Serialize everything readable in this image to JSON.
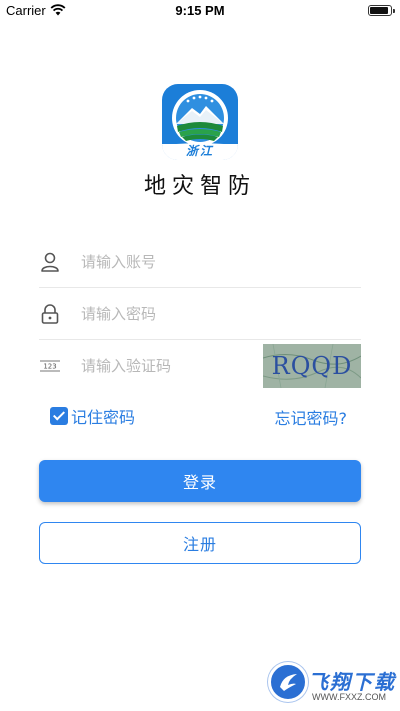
{
  "status_bar": {
    "carrier": "Carrier",
    "time": "9:15 PM"
  },
  "logo": {
    "badge_text": "浙江"
  },
  "app_name": "地灾智防",
  "form": {
    "account_placeholder": "请输入账号",
    "password_placeholder": "请输入密码",
    "captcha_placeholder": "请输入验证码",
    "captcha_code": "RQQD",
    "remember_label": "记住密码",
    "remember_checked": true,
    "forgot_label": "忘记密码?",
    "login_label": "登录",
    "register_label": "注册"
  },
  "watermark": {
    "title": "飞翔下载",
    "url": "WWW.FXXZ.COM"
  },
  "colors": {
    "accent": "#2f86f0",
    "link": "#2a7de1"
  }
}
